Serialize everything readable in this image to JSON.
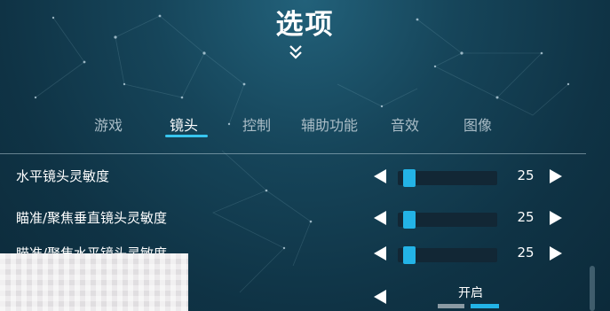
{
  "screen": {
    "title": "选项"
  },
  "tabs": [
    {
      "label": "游戏",
      "active": false
    },
    {
      "label": "镜头",
      "active": true
    },
    {
      "label": "控制",
      "active": false
    },
    {
      "label": "辅助功能",
      "active": false
    },
    {
      "label": "音效",
      "active": false
    },
    {
      "label": "图像",
      "active": false
    }
  ],
  "settings": [
    {
      "label": "水平镜头灵敏度",
      "type": "slider",
      "value": "25",
      "level_fraction": 0.12
    },
    {
      "label": "瞄准/聚焦垂直镜头灵敏度",
      "type": "slider",
      "value": "25",
      "level_fraction": 0.12
    },
    {
      "label": "瞄准/聚焦水平镜头灵敏度",
      "type": "slider",
      "value": "25",
      "level_fraction": 0.12
    },
    {
      "label": "",
      "type": "toggle",
      "value": "开启",
      "selected_option": 2,
      "option_count": 2
    }
  ],
  "icons": {
    "collapse": "double-chevron-down-icon",
    "decrease": "arrow-left-icon",
    "increase": "arrow-right-icon"
  },
  "colors": {
    "accent": "#23b3e6",
    "track": "#122735",
    "inactive_option": "#8a9aa3"
  }
}
